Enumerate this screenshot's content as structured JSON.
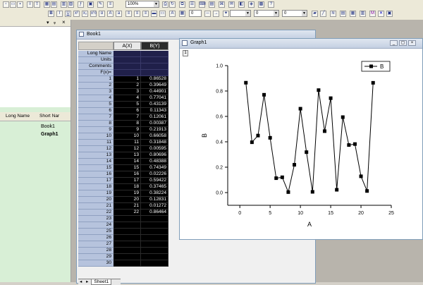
{
  "toolbar": {
    "zoom_value": "100%",
    "font_size_value": "0",
    "line_width_value": "0",
    "style_value": "0"
  },
  "explorer": {
    "col_long_name": "Long Name",
    "col_short_name": "Short Nar",
    "items": [
      {
        "short_name": "Book1"
      },
      {
        "short_name": "Graph1"
      }
    ]
  },
  "book": {
    "title": "Book1",
    "sheet_tab": "Sheet1",
    "columns": [
      "A(X)",
      "B(Y)"
    ],
    "meta_rows": [
      "Long Name",
      "Units",
      "Comments",
      "F(x)="
    ],
    "row_numbers": [
      "1",
      "2",
      "3",
      "4",
      "5",
      "6",
      "7",
      "8",
      "9",
      "10",
      "11",
      "12",
      "13",
      "14",
      "15",
      "16",
      "17",
      "18",
      "19",
      "20",
      "21",
      "22",
      "23",
      "24",
      "25",
      "26",
      "27",
      "28",
      "29",
      "30"
    ],
    "a_values": [
      "1",
      "2",
      "3",
      "4",
      "5",
      "6",
      "7",
      "8",
      "9",
      "10",
      "11",
      "12",
      "13",
      "14",
      "15",
      "16",
      "17",
      "18",
      "19",
      "20",
      "21",
      "22"
    ],
    "b_values": [
      "0.86528",
      "0.39649",
      "0.44901",
      "0.77041",
      "0.43139",
      "0.11343",
      "0.12061",
      "0.00387",
      "0.21913",
      "0.66058",
      "0.31848",
      "0.00595",
      "0.80696",
      "0.48388",
      "0.74349",
      "0.02226",
      "0.59422",
      "0.37465",
      "0.38224",
      "0.12831",
      "0.01272",
      "0.86464"
    ]
  },
  "graph": {
    "title": "Graph1",
    "layer": "1"
  },
  "chart_data": {
    "type": "line",
    "xlabel": "A",
    "ylabel": "B",
    "xlim": [
      -2,
      25
    ],
    "ylim": [
      -0.1,
      1.0
    ],
    "xticks": [
      0,
      5,
      10,
      15,
      20,
      25
    ],
    "yticks": [
      0.0,
      0.2,
      0.4,
      0.6,
      0.8,
      1.0
    ],
    "legend_position": "top-right",
    "series": [
      {
        "name": "B",
        "color": "#000000",
        "x": [
          1,
          2,
          3,
          4,
          5,
          6,
          7,
          8,
          9,
          10,
          11,
          12,
          13,
          14,
          15,
          16,
          17,
          18,
          19,
          20,
          21,
          22
        ],
        "y": [
          0.86528,
          0.39649,
          0.44901,
          0.77041,
          0.43139,
          0.11343,
          0.12061,
          0.00387,
          0.21913,
          0.66058,
          0.31848,
          0.00595,
          0.80696,
          0.48388,
          0.74349,
          0.02226,
          0.59422,
          0.37465,
          0.38224,
          0.12831,
          0.01272,
          0.86464
        ]
      }
    ]
  }
}
